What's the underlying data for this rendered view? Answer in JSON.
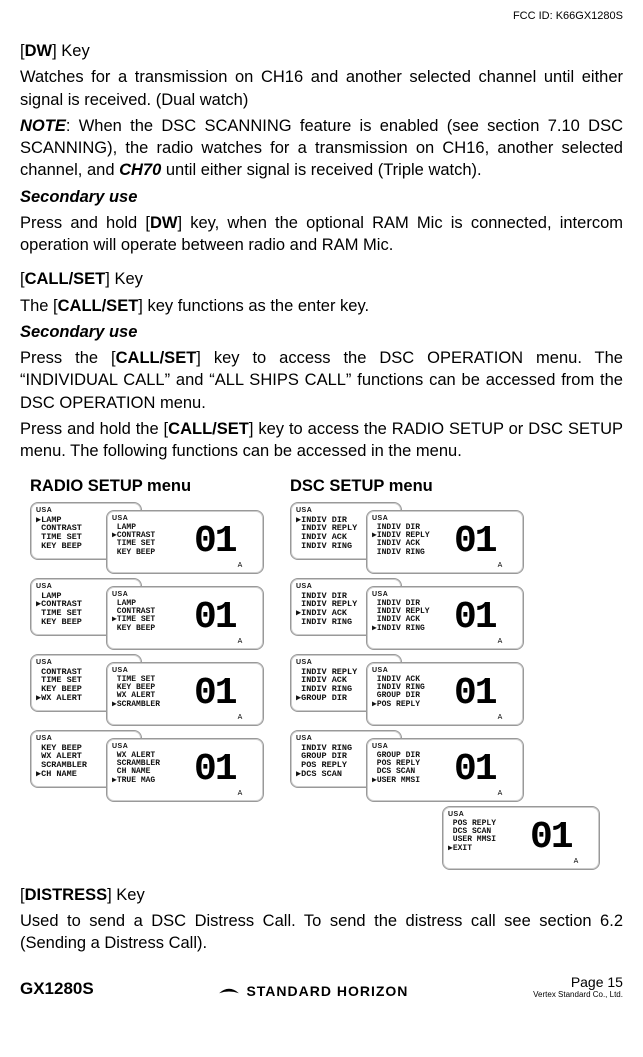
{
  "fcc_id": "FCC ID: K66GX1280S",
  "dw": {
    "key_label": "DW",
    "key_suffix": " Key",
    "para1": "Watches for a transmission on CH16 and another selected channel until either signal is received. (Dual watch)",
    "note_label": "NOTE",
    "note_rest_a": ": When the DSC SCANNING feature is enabled (see section 7.10 DSC SCANNING), the radio watches for a transmission on CH16, another selected channel, and ",
    "ch70": "CH70",
    "note_rest_b": " until either signal is received (Triple watch).",
    "sec_use_label": "Secondary use",
    "sec_use_body_a": "Press and hold [",
    "sec_use_key": "DW",
    "sec_use_body_b": "] key, when the optional RAM Mic is connected, intercom operation will operate between radio and RAM Mic."
  },
  "callset": {
    "key_label": "CALL/SET",
    "key_suffix": " Key",
    "line1_a": "The [",
    "line1_key": "CALL/SET",
    "line1_b": "] key functions as the enter key.",
    "sec_use_label": "Secondary use",
    "p2_a": "Press the [",
    "p2_key": "CALL/SET",
    "p2_b": "] key to access the DSC OPERATION menu. The “INDIVIDUAL CALL” and “ALL SHIPS CALL” functions can be accessed from the DSC OPERATION menu.",
    "p3_a": "Press and hold the [",
    "p3_key": "CALL/SET",
    "p3_b": "] key to access the RADIO SETUP or DSC SETUP menu. The following functions can be accessed in the menu."
  },
  "radio_menu": {
    "title": "RADIO SETUP menu",
    "items": [
      {
        "small": [
          "▶LAMP",
          " CONTRAST",
          " TIME SET",
          " KEY BEEP"
        ],
        "big": [
          " LAMP",
          "▶CONTRAST",
          " TIME SET",
          " KEY BEEP"
        ],
        "num": "01",
        "sub": "A"
      },
      {
        "small": [
          " LAMP",
          "▶CONTRAST",
          " TIME SET",
          " KEY BEEP"
        ],
        "big": [
          " LAMP",
          " CONTRAST",
          "▶TIME SET",
          " KEY BEEP"
        ],
        "num": "01",
        "sub": "A"
      },
      {
        "small": [
          " CONTRAST",
          " TIME SET",
          " KEY BEEP",
          "▶WX ALERT"
        ],
        "big": [
          " TIME SET",
          " KEY BEEP",
          " WX ALERT",
          "▶SCRAMBLER"
        ],
        "num": "01",
        "sub": "A"
      },
      {
        "small": [
          " KEY BEEP",
          " WX ALERT",
          " SCRAMBLER",
          "▶CH NAME"
        ],
        "big": [
          " WX ALERT",
          " SCRAMBLER",
          " CH NAME",
          "▶TRUE MAG"
        ],
        "num": "01",
        "sub": "A"
      }
    ]
  },
  "dsc_menu": {
    "title": "DSC SETUP menu",
    "items": [
      {
        "small": [
          "▶INDIV DIR",
          " INDIV REPLY",
          " INDIV ACK",
          " INDIV RING"
        ],
        "big": [
          " INDIV DIR",
          "▶INDIV REPLY",
          " INDIV ACK",
          " INDIV RING"
        ],
        "num": "01",
        "sub": "A"
      },
      {
        "small": [
          " INDIV DIR",
          " INDIV REPLY",
          "▶INDIV ACK",
          " INDIV RING"
        ],
        "big": [
          " INDIV DIR",
          " INDIV REPLY",
          " INDIV ACK",
          "▶INDIV RING"
        ],
        "num": "01",
        "sub": "A"
      },
      {
        "small": [
          " INDIV REPLY",
          " INDIV ACK",
          " INDIV RING",
          "▶GROUP DIR"
        ],
        "big": [
          " INDIV ACK",
          " INDIV RING",
          " GROUP DIR",
          "▶POS REPLY"
        ],
        "num": "01",
        "sub": "A"
      },
      {
        "small": [
          " INDIV RING",
          " GROUP DIR",
          " POS REPLY",
          "▶DCS SCAN"
        ],
        "big": [
          " GROUP DIR",
          " POS REPLY",
          " DCS SCAN",
          "▶USER MMSI"
        ],
        "num": "01",
        "sub": "A"
      }
    ],
    "last": {
      "big": [
        " POS REPLY",
        " DCS SCAN",
        " USER MMSI",
        "▶EXIT"
      ],
      "num": "01",
      "sub": "A"
    }
  },
  "distress": {
    "key_label": "DISTRESS",
    "key_suffix": " Key",
    "body": "Used to send a DSC Distress Call. To send the distress call see section 6.2 (Sending a Distress Call)."
  },
  "footer": {
    "model": "GX1280S",
    "brand": "STANDARD HORIZON",
    "page": "Page 15",
    "company": "Vertex Standard Co., Ltd."
  },
  "usa": "USA"
}
